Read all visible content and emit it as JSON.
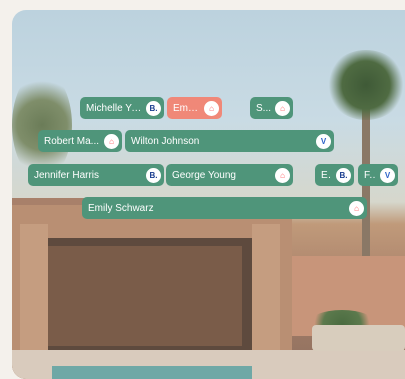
{
  "chips": [
    {
      "label": "Michelle Yao",
      "badge": "B.",
      "badge_icon": "booking-icon"
    },
    {
      "label": "Emil...",
      "badge": "⌂",
      "badge_icon": "airbnb-icon"
    },
    {
      "label": "S...",
      "badge": "⌂",
      "badge_icon": "airbnb-icon"
    },
    {
      "label": "Robert Ma...",
      "badge": "⌂",
      "badge_icon": "airbnb-icon"
    },
    {
      "label": "Wilton Johnson",
      "badge": "V",
      "badge_icon": "vrbo-icon"
    },
    {
      "label": "Jennifer Harris",
      "badge": "B.",
      "badge_icon": "booking-icon"
    },
    {
      "label": "George Young",
      "badge": "⌂",
      "badge_icon": "airbnb-icon"
    },
    {
      "label": "E...",
      "badge": "B.",
      "badge_icon": "booking-icon"
    },
    {
      "label": "F...",
      "badge": "V",
      "badge_icon": "vrbo-icon"
    },
    {
      "label": "Emily Schwarz",
      "badge": "⌂",
      "badge_icon": "airbnb-icon"
    }
  ],
  "colors": {
    "chip": "#4f957a",
    "chip_highlight": "#f08878"
  }
}
